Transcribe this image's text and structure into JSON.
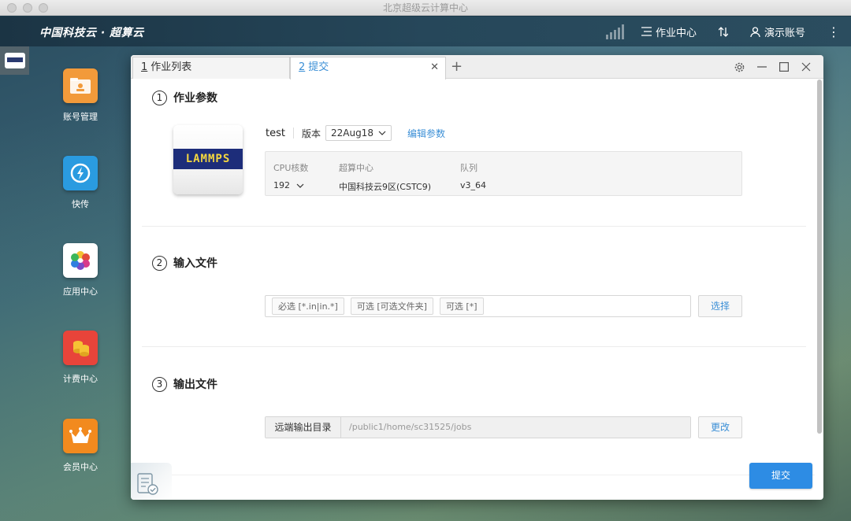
{
  "os": {
    "window_title": "北京超级云计算中心"
  },
  "topbar": {
    "brand": "中国科技云 · 超算云",
    "job_center": "作业中心",
    "account": "演示账号"
  },
  "dock": [
    {
      "label": "账号管理",
      "color": "#f29a3a",
      "icon": "folder-user-icon"
    },
    {
      "label": "快传",
      "color": "#2a9be0",
      "icon": "lightning-icon"
    },
    {
      "label": "应用中心",
      "color": "#ffffff",
      "icon": "pinwheel-icon"
    },
    {
      "label": "计费中心",
      "color": "#e8443a",
      "icon": "coins-icon"
    },
    {
      "label": "会员中心",
      "color": "#f28a1e",
      "icon": "crown-icon"
    }
  ],
  "tabs": [
    {
      "num": "1",
      "label": "作业列表"
    },
    {
      "num": "2",
      "label": "提交"
    }
  ],
  "sections": {
    "params": {
      "num": "1",
      "title": "作业参数"
    },
    "input": {
      "num": "2",
      "title": "输入文件"
    },
    "output": {
      "num": "3",
      "title": "输出文件"
    }
  },
  "job": {
    "app_logo_text": "LAMMPS",
    "name": "test",
    "version_label": "版本",
    "version_value": "22Aug18",
    "edit_link": "编辑参数",
    "cpu_label": "CPU核数",
    "cpu_value": "192",
    "center_label": "超算中心",
    "center_value": "中国科技云9区(CSTC9)",
    "queue_label": "队列",
    "queue_value": "v3_64"
  },
  "input_files": {
    "chips": [
      "必选 [*.in|in.*]",
      "可选 [可选文件夹]",
      "可选 [*]"
    ],
    "select_button": "选择"
  },
  "output": {
    "label": "远端输出目录",
    "path": "/public1/home/sc31525/jobs",
    "change_button": "更改"
  },
  "submit_button": "提交",
  "colors": {
    "accent": "#3b8fd6",
    "submit": "#2d8ce4"
  }
}
